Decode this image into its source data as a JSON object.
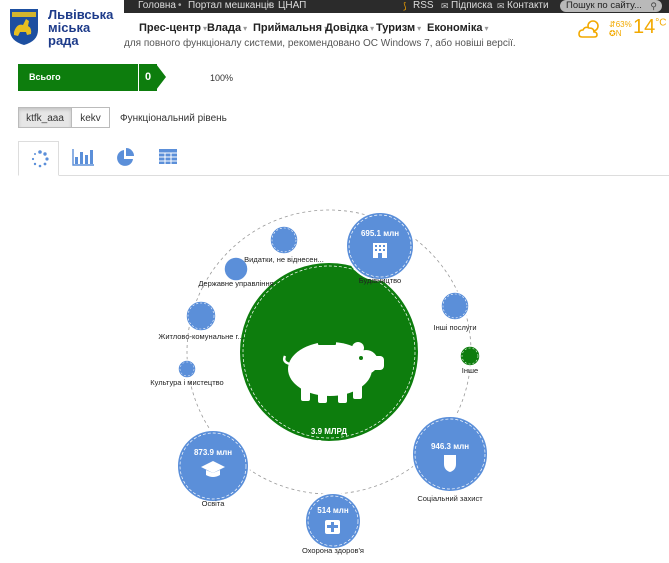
{
  "topbar": {
    "links": [
      "Головна",
      "Портал мешканців",
      "ЦНАП"
    ],
    "rss": "RSS",
    "subscribe": "Підписка",
    "contacts": "Контакти",
    "search_placeholder": "Пошук по сайту..."
  },
  "logo": {
    "line1": "Львівська",
    "line2": "міська",
    "line3": "рада"
  },
  "nav": {
    "items": [
      "Прес-центр",
      "Влада",
      "Приймальня",
      "Довідка",
      "Туризм",
      "Економіка"
    ]
  },
  "weather": {
    "temp": "14",
    "unit": "°C",
    "humidity": "63%",
    "wind": "N"
  },
  "notice": "для повного функціоналу системи, рекомендовано ОС Windows 7, або новіші версії.",
  "summary": {
    "label": "Всього",
    "count": "0",
    "percent": "100%"
  },
  "toggles": {
    "btn1": "ktfk_aaa",
    "btn2": "kekv",
    "level_label": "Функціональний рівень"
  },
  "tabs": [
    {
      "name": "tab-bubbles",
      "icon": "bubbles-icon"
    },
    {
      "name": "tab-bar",
      "icon": "bar-chart-icon"
    },
    {
      "name": "tab-pie",
      "icon": "pie-chart-icon"
    },
    {
      "name": "tab-table",
      "icon": "table-icon"
    }
  ],
  "colors": {
    "green": "#0d7d0d",
    "blue": "#5b8fd9"
  },
  "chart_data": {
    "type": "bubble",
    "center": {
      "value_label": "3.9 МЛРД",
      "label": "Всього"
    },
    "nodes": [
      {
        "label": "Будівництво",
        "value_label": "695.1 млн",
        "icon": "building-icon",
        "size": "large"
      },
      {
        "label": "Інші послуги",
        "value_label": "",
        "size": "small"
      },
      {
        "label": "Інше",
        "value_label": "",
        "size": "tiny",
        "highlight": true
      },
      {
        "label": "Соціальний захист",
        "value_label": "946.3 млн",
        "icon": "shield-icon",
        "size": "large"
      },
      {
        "label": "Охорона здоров'я",
        "value_label": "514 млн",
        "icon": "plus-icon",
        "size": "medium"
      },
      {
        "label": "Освіта",
        "value_label": "873.9 млн",
        "icon": "graduation-cap-icon",
        "size": "large"
      },
      {
        "label": "Культура і мистецтво",
        "value_label": "",
        "size": "tiny"
      },
      {
        "label": "Житлово-комунальне г...",
        "value_label": "",
        "size": "small"
      },
      {
        "label": "Державне управління",
        "value_label": "",
        "size": "small"
      },
      {
        "label": "Видатки, не віднесен...",
        "value_label": "",
        "size": "small"
      }
    ]
  }
}
